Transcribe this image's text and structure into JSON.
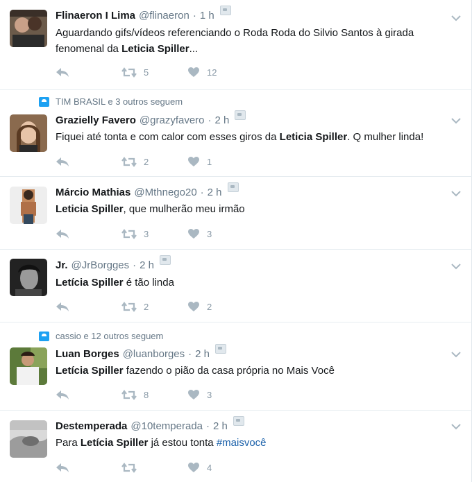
{
  "tweets": [
    {
      "context": "",
      "name": "Flinaeron I Lima",
      "handle": "@flinaeron",
      "time": "1 h",
      "text_segments": [
        {
          "t": "Aguardando gifs/vídeos referenciando o Roda Roda do Silvio Santos à girada fenomenal da ",
          "b": false
        },
        {
          "t": "Leticia Spiller",
          "b": true
        },
        {
          "t": "...",
          "b": false
        }
      ],
      "retweets": "5",
      "likes": "12"
    },
    {
      "context": "TIM BRASIL e 3 outros seguem",
      "name": "Grazielly Favero",
      "handle": "@grazyfavero",
      "time": "2 h",
      "text_segments": [
        {
          "t": "Fiquei até tonta e com calor com esses giros da ",
          "b": false
        },
        {
          "t": "Leticia Spiller",
          "b": true
        },
        {
          "t": ". Q mulher linda!",
          "b": false
        }
      ],
      "retweets": "2",
      "likes": "1"
    },
    {
      "context": "",
      "name": "Márcio Mathias",
      "handle": "@Mthnego20",
      "time": "2 h",
      "text_segments": [
        {
          "t": "Leticia Spiller",
          "b": true
        },
        {
          "t": ", que mulherão meu irmão",
          "b": false
        }
      ],
      "retweets": "3",
      "likes": "3"
    },
    {
      "context": "",
      "name": "Jr.",
      "handle": "@JrBorgges",
      "time": "2 h",
      "text_segments": [
        {
          "t": "Letícia Spiller",
          "b": true
        },
        {
          "t": " é tão linda",
          "b": false
        }
      ],
      "retweets": "2",
      "likes": "2"
    },
    {
      "context": "cassio e 12 outros seguem",
      "name": "Luan Borges",
      "handle": "@luanborges",
      "time": "2 h",
      "text_segments": [
        {
          "t": "Letícia Spiller",
          "b": true
        },
        {
          "t": " fazendo o pião da casa própria no Mais Você",
          "b": false
        }
      ],
      "retweets": "8",
      "likes": "3"
    },
    {
      "context": "",
      "name": "Destemperada",
      "handle": "@10temperada",
      "time": "2 h",
      "text_segments": [
        {
          "t": "Para ",
          "b": false
        },
        {
          "t": "Letícia Spiller",
          "b": true
        },
        {
          "t": " já estou tonta ",
          "b": false
        },
        {
          "t": "#maisvocê",
          "b": false,
          "hashtag": true
        }
      ],
      "retweets": "",
      "likes": "4"
    }
  ],
  "separator": "·",
  "colors": {
    "accent": "#1da1f2",
    "muted": "#657786",
    "icon": "#8899a6",
    "hashtag": "#1b61aa"
  },
  "icons": {
    "reply": "reply-icon",
    "retweet": "retweet-icon",
    "like": "heart-icon",
    "menu": "chevron-down-icon"
  }
}
